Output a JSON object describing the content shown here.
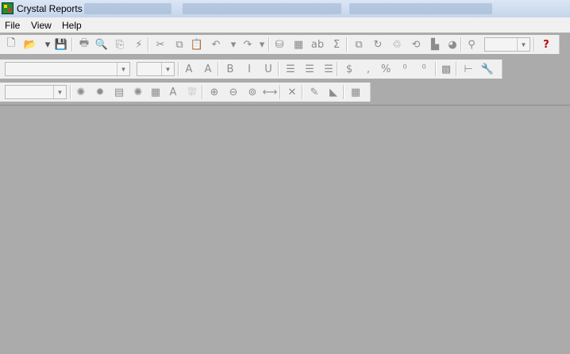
{
  "window": {
    "title": "Crystal Reports"
  },
  "menu": [
    {
      "label": "File"
    },
    {
      "label": "View"
    },
    {
      "label": "Help"
    }
  ],
  "toolbar1": {
    "buttons": [
      {
        "name": "new-icon",
        "glyph": "🗋",
        "enabled": true
      },
      {
        "name": "open-icon",
        "glyph": "📂",
        "enabled": true
      },
      {
        "name": "open-dropdown-icon",
        "glyph": "▾",
        "enabled": true
      },
      {
        "name": "save-icon",
        "glyph": "💾",
        "enabled": false
      },
      {
        "name": "print-icon",
        "glyph": "🖶",
        "enabled": false
      },
      {
        "name": "print-preview-icon",
        "glyph": "🔍",
        "enabled": false
      },
      {
        "name": "export-icon",
        "glyph": "⎘",
        "enabled": false
      },
      {
        "name": "refresh-icon",
        "glyph": "⚡",
        "enabled": false
      },
      {
        "name": "cut-icon",
        "glyph": "✂",
        "enabled": false
      },
      {
        "name": "copy-icon",
        "glyph": "⧉",
        "enabled": false
      },
      {
        "name": "paste-icon",
        "glyph": "📋",
        "enabled": false
      },
      {
        "name": "undo-icon",
        "glyph": "↶",
        "enabled": false
      },
      {
        "name": "undo-dropdown-icon",
        "glyph": "▾",
        "enabled": false
      },
      {
        "name": "redo-icon",
        "glyph": "↷",
        "enabled": false
      },
      {
        "name": "redo-dropdown-icon",
        "glyph": "▾",
        "enabled": false
      },
      {
        "name": "database-expert-icon",
        "glyph": "⛁",
        "enabled": false
      },
      {
        "name": "insert-field-icon",
        "glyph": "▦",
        "enabled": false
      },
      {
        "name": "insert-text-icon",
        "glyph": "ab",
        "enabled": false
      },
      {
        "name": "summary-icon",
        "glyph": "Σ",
        "enabled": false
      },
      {
        "name": "insert-group-icon",
        "glyph": "⧉",
        "enabled": false
      },
      {
        "name": "insert-chart-icon",
        "glyph": "↻",
        "enabled": false
      },
      {
        "name": "formula-icon",
        "glyph": "♲",
        "enabled": false
      },
      {
        "name": "select-expert-icon",
        "glyph": "⟲",
        "enabled": false
      },
      {
        "name": "section-expert-icon",
        "glyph": "▙",
        "enabled": false
      },
      {
        "name": "olap-icon",
        "glyph": "◕",
        "enabled": false
      },
      {
        "name": "find-icon",
        "glyph": "⚲",
        "enabled": false
      }
    ],
    "zoom_value": "",
    "help": {
      "name": "help-icon",
      "glyph": "?"
    }
  },
  "toolbar2": {
    "font_value": "",
    "size_value": "",
    "buttons": [
      {
        "name": "increase-font-icon",
        "glyph": "A",
        "enabled": false
      },
      {
        "name": "decrease-font-icon",
        "glyph": "A",
        "enabled": false
      },
      {
        "name": "bold-icon",
        "glyph": "B",
        "enabled": false
      },
      {
        "name": "italic-icon",
        "glyph": "I",
        "enabled": false
      },
      {
        "name": "underline-icon",
        "glyph": "U",
        "enabled": false
      },
      {
        "name": "align-left-icon",
        "glyph": "☰",
        "enabled": false
      },
      {
        "name": "align-center-icon",
        "glyph": "☰",
        "enabled": false
      },
      {
        "name": "align-right-icon",
        "glyph": "☰",
        "enabled": false
      },
      {
        "name": "currency-icon",
        "glyph": "$",
        "enabled": false
      },
      {
        "name": "thousands-icon",
        "glyph": ",",
        "enabled": false
      },
      {
        "name": "percent-icon",
        "glyph": "%",
        "enabled": false
      },
      {
        "name": "increase-decimal-icon",
        "glyph": "⁰",
        "enabled": false
      },
      {
        "name": "decrease-decimal-icon",
        "glyph": "⁰",
        "enabled": false
      },
      {
        "name": "border-icon",
        "glyph": "▩",
        "enabled": false
      },
      {
        "name": "group-tree-icon",
        "glyph": "⊢",
        "enabled": false
      },
      {
        "name": "tools-icon",
        "glyph": "🔧",
        "enabled": true
      }
    ]
  },
  "toolbar3": {
    "combo_value": "",
    "buttons": [
      {
        "name": "insert-section-icon",
        "glyph": "✺",
        "enabled": false
      },
      {
        "name": "insert-group2-icon",
        "glyph": "✹",
        "enabled": false
      },
      {
        "name": "insert-summary2-icon",
        "glyph": "▤",
        "enabled": false
      },
      {
        "name": "insert-crosstab-icon",
        "glyph": "✺",
        "enabled": false
      },
      {
        "name": "insert-box-icon",
        "glyph": "▦",
        "enabled": false
      },
      {
        "name": "insert-text-object-icon",
        "glyph": "A",
        "enabled": false
      },
      {
        "name": "insert-picture-icon",
        "glyph": "⛆",
        "enabled": false
      },
      {
        "name": "zoom-in-icon",
        "glyph": "⊕",
        "enabled": false
      },
      {
        "name": "zoom-out-icon",
        "glyph": "⊖",
        "enabled": false
      },
      {
        "name": "zoom-page-icon",
        "glyph": "⊚",
        "enabled": false
      },
      {
        "name": "page-width-icon",
        "glyph": "⟷",
        "enabled": false
      },
      {
        "name": "close-section-icon",
        "glyph": "✕",
        "enabled": false
      },
      {
        "name": "insert-line-icon",
        "glyph": "✎",
        "enabled": false
      },
      {
        "name": "insert-ole-icon",
        "glyph": "◣",
        "enabled": false
      },
      {
        "name": "grid-icon",
        "glyph": "▦",
        "enabled": false
      }
    ]
  }
}
